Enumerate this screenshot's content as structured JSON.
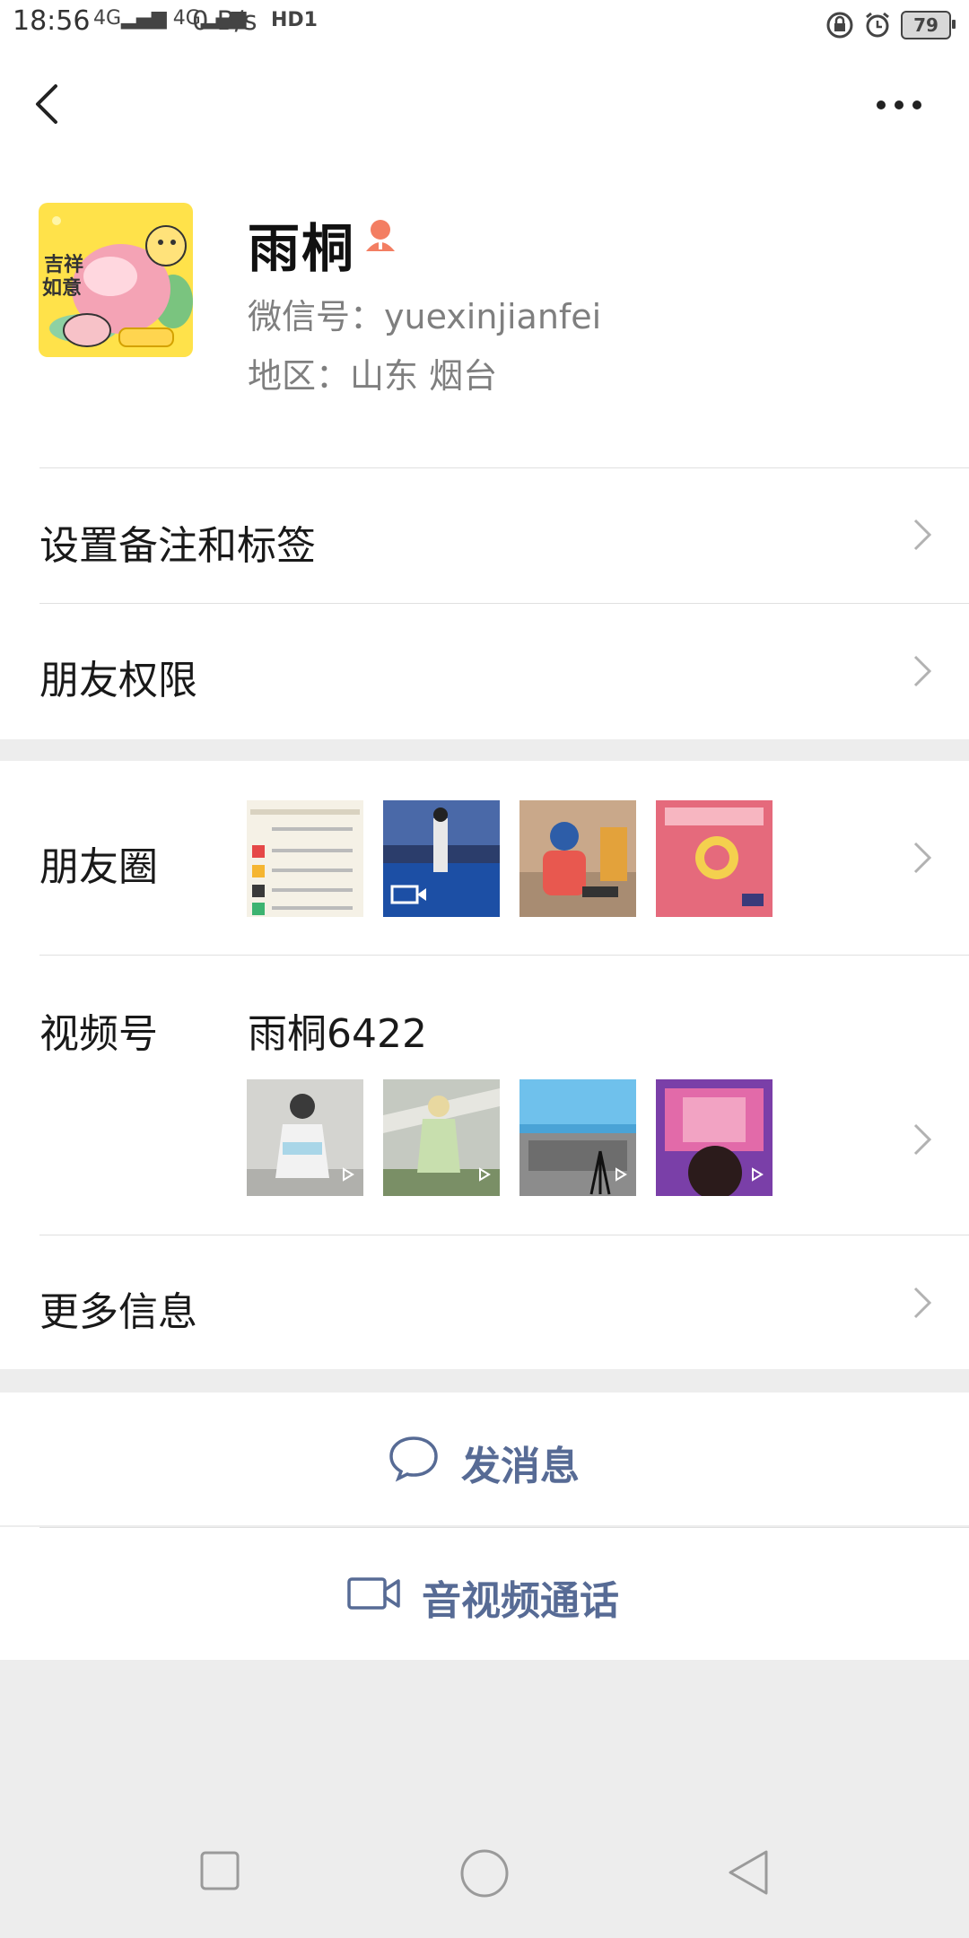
{
  "status": {
    "time": "18:56",
    "net1": "4G",
    "net2": "4G",
    "speed": "0 B/s",
    "hd": "HD1",
    "battery": "79"
  },
  "profile": {
    "name": "雨桐",
    "wechat_id": "微信号：yuexinjianfei",
    "region": "地区：山东  烟台"
  },
  "rows": {
    "remark": "设置备注和标签",
    "permissions": "朋友权限",
    "moments": "朋友圈",
    "channels_label": "视频号",
    "channels_name": "雨桐6422",
    "more_info": "更多信息"
  },
  "actions": {
    "message": "发消息",
    "call": "音视频通话"
  },
  "colors": {
    "link": "#576b95",
    "divider": "#e0e0e0",
    "background": "#ededed"
  }
}
